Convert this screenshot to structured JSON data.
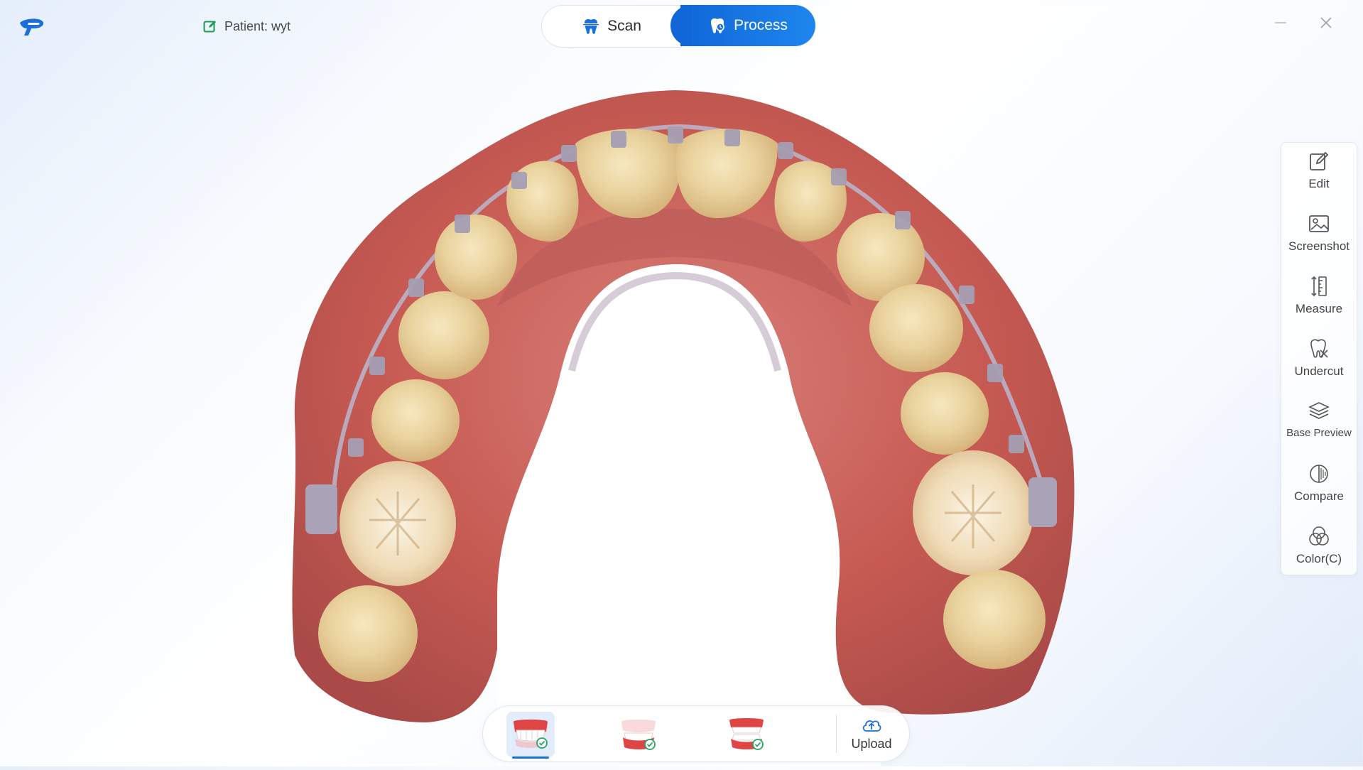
{
  "header": {
    "patient_label": "Patient: wyt",
    "tabs": [
      {
        "label": "Scan",
        "active": false
      },
      {
        "label": "Process",
        "active": true
      }
    ]
  },
  "toolbar": {
    "items": [
      {
        "label": "Edit",
        "icon": "edit-icon"
      },
      {
        "label": "Screenshot",
        "icon": "screenshot-icon"
      },
      {
        "label": "Measure",
        "icon": "measure-icon"
      },
      {
        "label": "Undercut",
        "icon": "undercut-icon"
      },
      {
        "label": "Base Preview",
        "icon": "base-preview-icon"
      },
      {
        "label": "Compare",
        "icon": "compare-icon"
      },
      {
        "label": "Color(C)",
        "icon": "color-icon"
      }
    ]
  },
  "bottom_bar": {
    "jaws": [
      {
        "icon": "upper-jaw-icon",
        "active": true
      },
      {
        "icon": "lower-jaw-icon",
        "active": false
      },
      {
        "icon": "both-jaws-icon",
        "active": false
      }
    ],
    "upload_label": "Upload"
  },
  "colors": {
    "accent": "#1a6fdd",
    "patient_icon": "#1a9b54",
    "gum": "#c65a52",
    "tooth": "#ecd9a6"
  }
}
